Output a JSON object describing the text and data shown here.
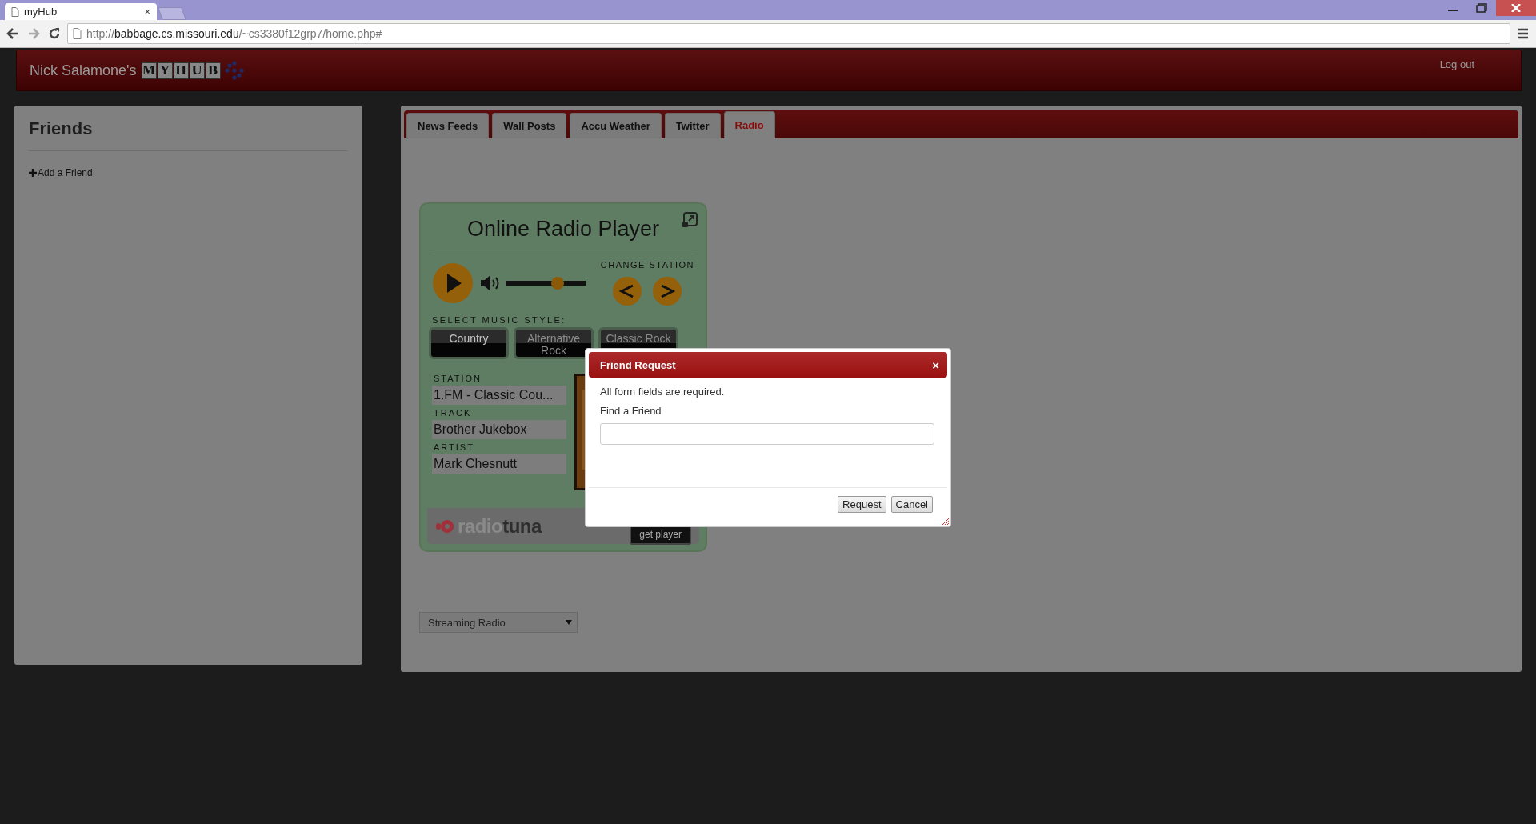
{
  "browser": {
    "tab": {
      "title": "myHub",
      "close": "×"
    },
    "address": {
      "scheme": "http://",
      "host": "babbage.cs.missouri.edu",
      "path": "/~cs3380f12grp7/home.php#"
    }
  },
  "header": {
    "owner": "Nick Salamone's",
    "logo_letters": [
      "M",
      "Y",
      "H",
      "U",
      "B"
    ],
    "logout": "Log out"
  },
  "friends": {
    "title": "Friends",
    "add": "Add a Friend"
  },
  "tabs": [
    {
      "label": "News Feeds",
      "selected": false
    },
    {
      "label": "Wall Posts",
      "selected": false
    },
    {
      "label": "Accu Weather",
      "selected": false
    },
    {
      "label": "Twitter",
      "selected": false
    },
    {
      "label": "Radio",
      "selected": true
    }
  ],
  "radio_player": {
    "title": "Online Radio Player",
    "volume": {
      "level": 0.65
    },
    "change_station": "CHANGE STATION",
    "style_heading": "SELECT MUSIC STYLE:",
    "styles": [
      {
        "label": "Country",
        "selected": true
      },
      {
        "label": "Alternative Rock",
        "selected": false
      },
      {
        "label": "Classic Rock",
        "selected": false
      }
    ],
    "fields": [
      {
        "label": "STATION",
        "value": "1.FM - Classic Cou..."
      },
      {
        "label": "TRACK",
        "value": "Brother Jukebox"
      },
      {
        "label": "ARTIST",
        "value": "Mark Chesnutt"
      }
    ],
    "brand": {
      "first": "radio",
      "second": "tuna"
    },
    "get_player": "get player"
  },
  "station_select": {
    "value": "Streaming Radio"
  },
  "dialog": {
    "title": "Friend Request",
    "close": "×",
    "note": "All form fields are required.",
    "field_label": "Find a Friend",
    "buttons": [
      "Request",
      "Cancel"
    ]
  }
}
